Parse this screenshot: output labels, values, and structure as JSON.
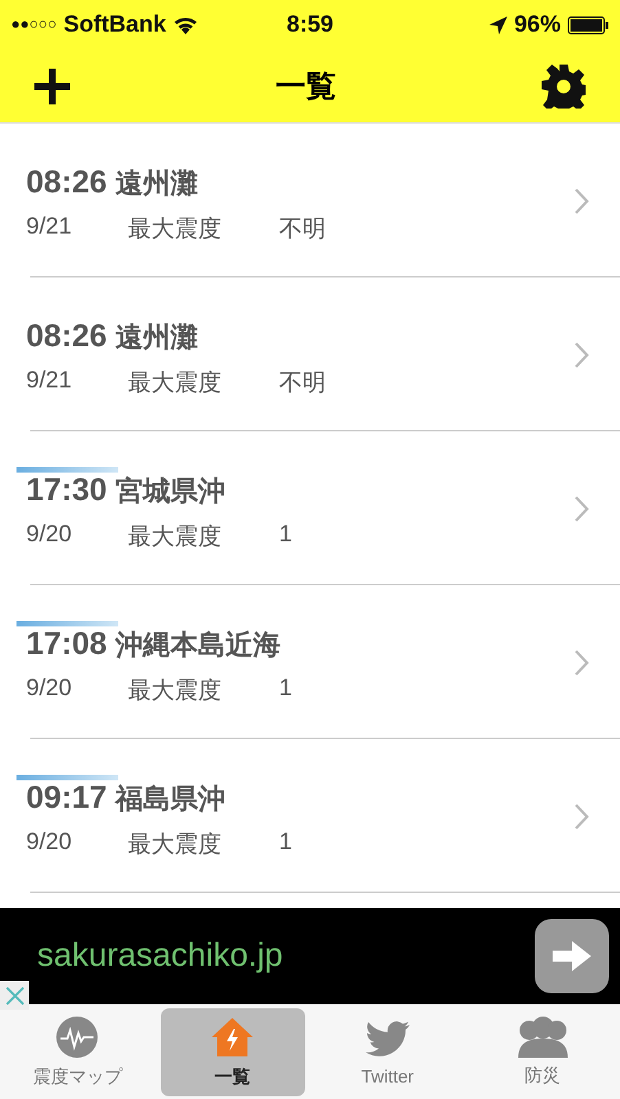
{
  "status_bar": {
    "signal_bars": "●●○○○",
    "carrier": "SoftBank",
    "time": "8:59",
    "battery": "96%"
  },
  "nav": {
    "title": "一覧"
  },
  "quakes": [
    {
      "time": "08:26",
      "place": "遠州灘",
      "date": "9/21",
      "label": "最大震度",
      "intensity": "不明",
      "highlight": false
    },
    {
      "time": "08:26",
      "place": "遠州灘",
      "date": "9/21",
      "label": "最大震度",
      "intensity": "不明",
      "highlight": false
    },
    {
      "time": "17:30",
      "place": "宮城県沖",
      "date": "9/20",
      "label": "最大震度",
      "intensity": "1",
      "highlight": true
    },
    {
      "time": "17:08",
      "place": "沖縄本島近海",
      "date": "9/20",
      "label": "最大震度",
      "intensity": "1",
      "highlight": true
    },
    {
      "time": "09:17",
      "place": "福島県沖",
      "date": "9/20",
      "label": "最大震度",
      "intensity": "1",
      "highlight": true
    }
  ],
  "ad": {
    "text": "sakurasachiko.jp"
  },
  "tabs": [
    {
      "label": "震度マップ",
      "kind": "wave",
      "selected": false
    },
    {
      "label": "一覧",
      "kind": "house",
      "selected": true
    },
    {
      "label": "Twitter",
      "kind": "bird",
      "selected": false
    },
    {
      "label": "防災",
      "kind": "people",
      "selected": false
    }
  ]
}
